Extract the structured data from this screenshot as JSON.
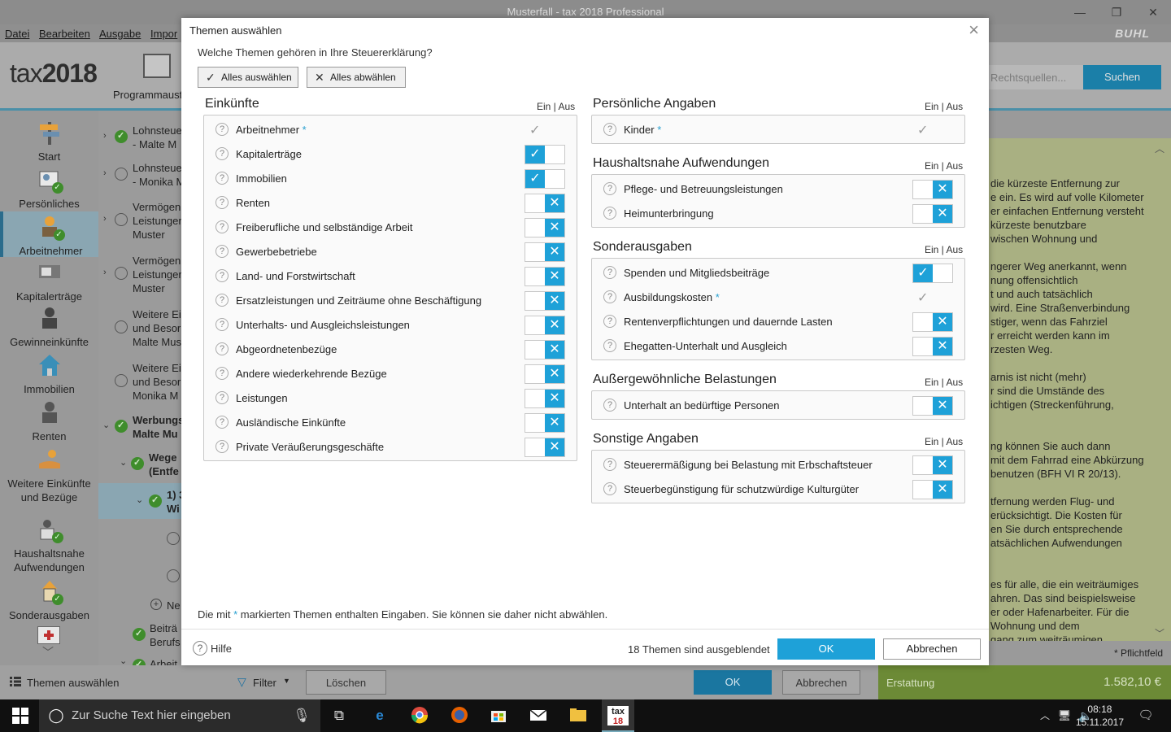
{
  "window": {
    "title": "Musterfall - tax 2018 Professional",
    "minimize": "—",
    "maximize": "❐",
    "close": "✕"
  },
  "menu": [
    "Datei",
    "Bearbeiten",
    "Ausgabe",
    "Impor"
  ],
  "brand": "BUHL",
  "app": {
    "logo_light": "tax",
    "logo_bold": "2018",
    "program_label": "Programmaust"
  },
  "search": {
    "placeholder": "Rechtsquellen...",
    "button": "Suchen"
  },
  "sidebar": {
    "items": [
      {
        "label": "Start"
      },
      {
        "label": "Persönliches"
      },
      {
        "label": "Arbeitnehmer"
      },
      {
        "label": "Kapitalerträge"
      },
      {
        "label": "Gewinneinkünfte"
      },
      {
        "label": "Immobilien"
      },
      {
        "label": "Renten"
      },
      {
        "label": "Weitere Einkünfte und Bezüge"
      },
      {
        "label": "Haushaltsnahe Aufwendungen"
      },
      {
        "label": "Sonderausgaben"
      }
    ]
  },
  "tree": {
    "nodes": [
      {
        "l1": "Lohnsteue",
        "l2": "- Malte M"
      },
      {
        "l1": "Lohnsteue",
        "l2": "- Monika M"
      },
      {
        "l1": "Vermögen",
        "l2": "Leistunger",
        "l3": "Muster"
      },
      {
        "l1": "Vermögen",
        "l2": "Leistunger",
        "l3": "Muster"
      },
      {
        "l1": "Weitere Ei",
        "l2": "und Besor",
        "l3": "Malte Mus"
      },
      {
        "l1": "Weitere Ei",
        "l2": "und Besor",
        "l3": "Monika M"
      },
      {
        "l1": "Werbungs",
        "l2": "Malte Mu"
      },
      {
        "l1": "Wege",
        "l2": "(Entfe"
      },
      {
        "l1": "1) 3",
        "l2": "Wi"
      },
      {
        "l1": "Ne"
      },
      {
        "l1": "Beiträ",
        "l2": "Berufs"
      },
      {
        "l1": "Arbeit"
      }
    ]
  },
  "right_panel": {
    "lines": [
      "die kürzeste Entfernung zur",
      "e ein. Es wird auf volle Kilometer",
      "er einfachen Entfernung versteht",
      "kürzeste benutzbare",
      "wischen Wohnung und",
      "",
      "ngerer Weg anerkannt, wenn",
      "nung offensichtlich",
      "t und auch tatsächlich",
      "wird. Eine Straßenverbindung",
      "stiger, wenn das Fahrziel",
      "r erreicht werden kann im",
      "rzesten Weg.",
      "",
      "arnis ist nicht (mehr)",
      "r sind die Umstände des",
      "ichtigen (Streckenführung,",
      "",
      "",
      "ng können Sie auch dann",
      "mit dem Fahrrad eine Abkürzung",
      "benutzen (BFH VI R 20/13).",
      "",
      "tfernung werden Flug- und",
      "erücksichtigt. Die Kosten für",
      "en Sie durch entsprechende",
      "atsächlichen Aufwendungen",
      "",
      "",
      "es für alle, die ein weiträumiges",
      "ahren. Das sind beispielsweise",
      "er oder Hafenarbeiter. Für die",
      "Wohnung und dem",
      "gang zum weiträumigen"
    ],
    "required_note": "* Pflichtfeld"
  },
  "bottom": {
    "themen": "Themen auswählen",
    "filter": "Filter",
    "loeschen": "Löschen",
    "ok": "OK",
    "abbrechen": "Abbrechen",
    "erstattung_label": "Erstattung",
    "erstattung_value": "1.582,10 €"
  },
  "taskbar": {
    "search_placeholder": "Zur Suche Text hier eingeben",
    "time": "08:18",
    "date": "15.11.2017"
  },
  "dialog": {
    "title": "Themen auswählen",
    "question": "Welche Themen gehören in Ihre Steuererklärung?",
    "select_all": "Alles auswählen",
    "deselect_all": "Alles abwählen",
    "ein_aus": "Ein | Aus",
    "note_before": "Die mit ",
    "note_star": "*",
    "note_after": " markierten Themen enthalten Eingaben. Sie können sie daher nicht abwählen.",
    "help": "Hilfe",
    "hidden_count": "18 Themen sind ausgeblendet",
    "ok": "OK",
    "cancel": "Abbrechen",
    "accent_color": "#1ea1d8",
    "sections_left": [
      {
        "title": "Einkünfte",
        "items": [
          {
            "label": "Arbeitnehmer",
            "star": true,
            "state": "fixed"
          },
          {
            "label": "Kapitalerträge",
            "state": "on"
          },
          {
            "label": "Immobilien",
            "state": "on"
          },
          {
            "label": "Renten",
            "state": "off"
          },
          {
            "label": "Freiberufliche und selbständige Arbeit",
            "state": "off"
          },
          {
            "label": "Gewerbebetriebe",
            "state": "off"
          },
          {
            "label": "Land- und Forstwirtschaft",
            "state": "off"
          },
          {
            "label": "Ersatzleistungen und Zeiträume ohne Beschäftigung",
            "state": "off"
          },
          {
            "label": "Unterhalts- und Ausgleichsleistungen",
            "state": "off"
          },
          {
            "label": "Abgeordnetenbezüge",
            "state": "off"
          },
          {
            "label": "Andere wiederkehrende Bezüge",
            "state": "off"
          },
          {
            "label": "Leistungen",
            "state": "off"
          },
          {
            "label": "Ausländische Einkünfte",
            "state": "off"
          },
          {
            "label": "Private Veräußerungsgeschäfte",
            "state": "off"
          }
        ]
      }
    ],
    "sections_right": [
      {
        "title": "Persönliche Angaben",
        "items": [
          {
            "label": "Kinder",
            "star": true,
            "state": "fixed"
          }
        ]
      },
      {
        "title": "Haushaltsnahe Aufwendungen",
        "items": [
          {
            "label": "Pflege- und Betreuungsleistungen",
            "state": "off"
          },
          {
            "label": "Heimunterbringung",
            "state": "off"
          }
        ]
      },
      {
        "title": "Sonderausgaben",
        "items": [
          {
            "label": "Spenden und Mitgliedsbeiträge",
            "state": "on"
          },
          {
            "label": "Ausbildungskosten",
            "star": true,
            "state": "fixed"
          },
          {
            "label": "Rentenverpflichtungen und dauernde Lasten",
            "state": "off"
          },
          {
            "label": "Ehegatten-Unterhalt und Ausgleich",
            "state": "off"
          }
        ]
      },
      {
        "title": "Außergewöhnliche Belastungen",
        "items": [
          {
            "label": "Unterhalt an bedürftige Personen",
            "state": "off"
          }
        ]
      },
      {
        "title": "Sonstige Angaben",
        "items": [
          {
            "label": "Steuerermäßigung bei Belastung mit Erbschaftsteuer",
            "state": "off"
          },
          {
            "label": "Steuerbegünstigung für schutzwürdige Kulturgüter",
            "state": "off"
          }
        ]
      }
    ]
  }
}
